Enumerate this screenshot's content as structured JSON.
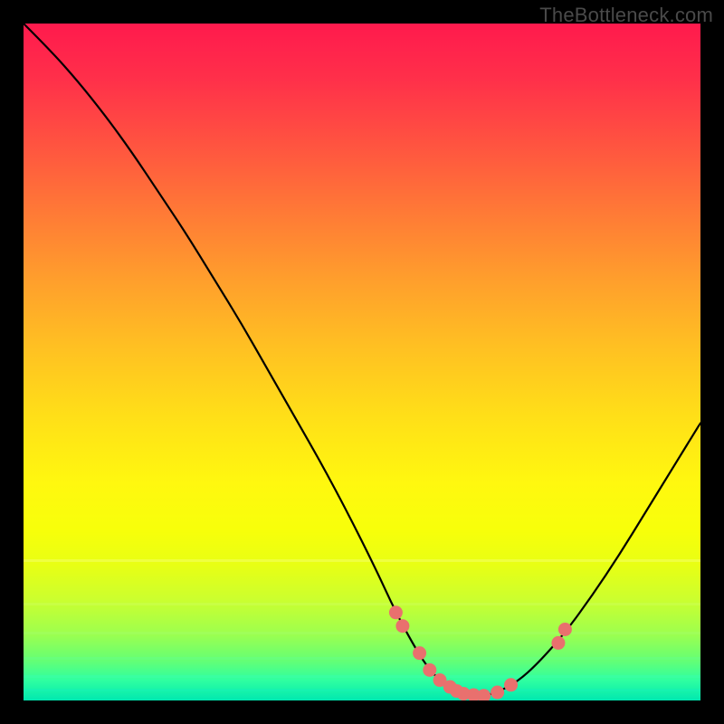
{
  "watermark": "TheBottleneck.com",
  "colors": {
    "frame_bg": "#000000",
    "curve_stroke": "#000000",
    "dot_fill": "#e9706e",
    "dot_stroke": "#c24b49"
  },
  "chart_data": {
    "type": "line",
    "title": "",
    "xlabel": "",
    "ylabel": "",
    "xlim": [
      0,
      100
    ],
    "ylim": [
      0,
      100
    ],
    "grid": false,
    "legend": false,
    "series": [
      {
        "name": "bottleneck-curve",
        "x": [
          0,
          4,
          8,
          12,
          16,
          20,
          24,
          28,
          32,
          36,
          40,
          44,
          48,
          52,
          55,
          58,
          60,
          62,
          64,
          66,
          68,
          70,
          73,
          76,
          80,
          84,
          88,
          92,
          96,
          100
        ],
        "y": [
          100,
          96,
          91.5,
          86.5,
          81,
          75,
          69,
          62.5,
          56,
          49,
          42,
          35,
          27.5,
          19.5,
          13,
          7.5,
          4.5,
          2.5,
          1.3,
          0.7,
          0.7,
          1.2,
          2.8,
          5.5,
          10,
          15.5,
          21.5,
          28,
          34.5,
          41
        ]
      }
    ],
    "dots": {
      "name": "highlight-dots",
      "x": [
        55,
        56,
        58.5,
        60,
        61.5,
        63,
        64,
        65,
        66.5,
        68,
        70,
        72,
        79,
        80
      ],
      "y": [
        13,
        11,
        7,
        4.5,
        3,
        2,
        1.4,
        1,
        0.8,
        0.7,
        1.2,
        2.3,
        8.5,
        10.5
      ]
    }
  }
}
